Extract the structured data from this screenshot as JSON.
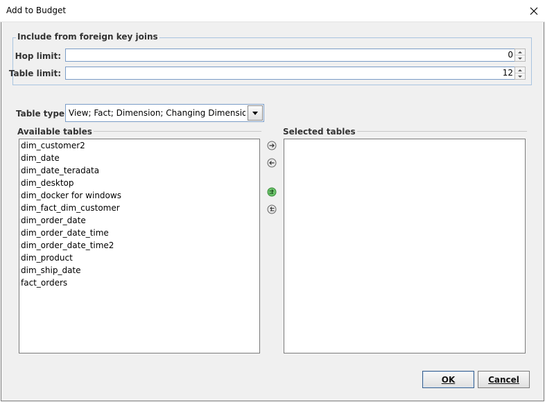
{
  "window": {
    "title": "Add to Budget"
  },
  "fk_group": {
    "title": "Include from foreign key joins",
    "hop_limit_label": "Hop limit:",
    "hop_limit_value": "0",
    "table_limit_label": "Table limit:",
    "table_limit_value": "12"
  },
  "table_type": {
    "label": "Table type:",
    "value": "View; Fact; Dimension; Changing Dimension..."
  },
  "available": {
    "label": "Available tables",
    "items": [
      "dim_customer2",
      "dim_date",
      "dim_date_teradata",
      "dim_desktop",
      "dim_docker for windows",
      "dim_fact_dim_customer",
      "dim_order_date",
      "dim_order_date_time",
      "dim_order_date_time2",
      "dim_product",
      "dim_ship_date",
      "fact_orders"
    ]
  },
  "selected": {
    "label": "Selected tables",
    "items": []
  },
  "buttons": {
    "ok": "OK",
    "cancel": "Cancel"
  },
  "colors": {
    "accent_border": "#7a9cc6",
    "group_border": "#a8c4e0",
    "move_all_green": "#4caf50"
  }
}
